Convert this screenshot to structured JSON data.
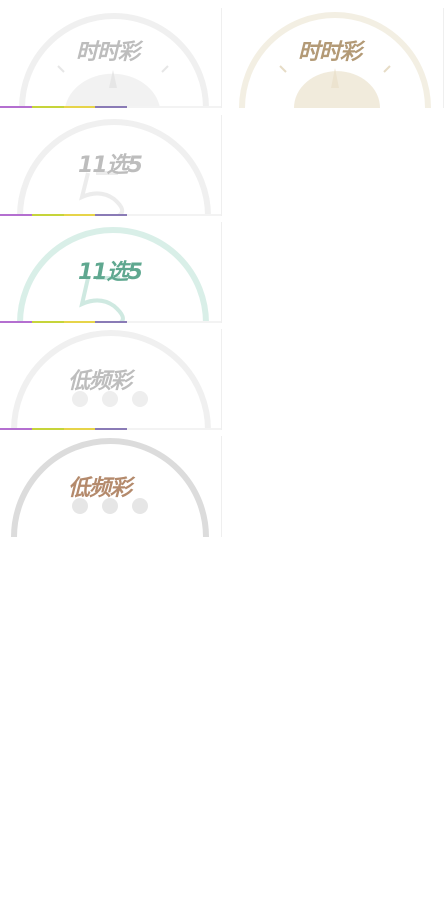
{
  "sprites": {
    "ssc_gray": {
      "label": "时时彩",
      "color": "#bdbdbd"
    },
    "ssc_gold": {
      "label": "时时彩",
      "color": "#b39a76"
    },
    "x115_gray": {
      "label": "11选5",
      "color": "#bdbdbd"
    },
    "x115_green": {
      "label": "11选5",
      "color": "#5fa890"
    },
    "dpc_gray": {
      "label": "低频彩",
      "color": "#bdbdbd"
    },
    "dpc_brown": {
      "label": "低频彩",
      "color": "#b48a6c"
    }
  },
  "colors": {
    "stripe": [
      "#b46fd0",
      "#c6d43a",
      "#e6d44a",
      "#8a7bb6"
    ],
    "ring_gray": "#f0f0f0",
    "ring_gold": "#f3efe3",
    "ring_green": "#d9efe8",
    "ring_dark": "#dcdcdc",
    "dot": "#e8e8e8"
  }
}
